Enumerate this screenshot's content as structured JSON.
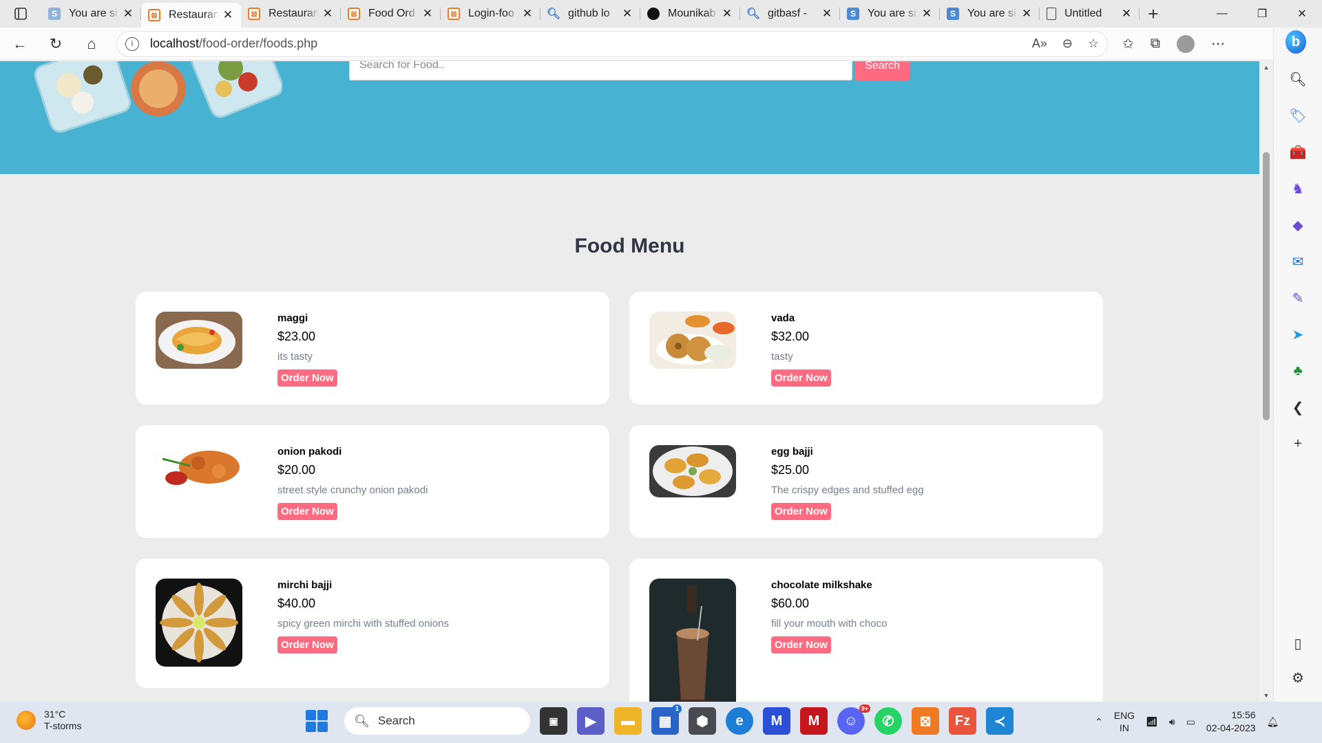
{
  "browser": {
    "tabs": [
      {
        "title": "You are si",
        "icon": "s-icon"
      },
      {
        "title": "Restauran",
        "icon": "xampp-icon",
        "active": true
      },
      {
        "title": "Restauran",
        "icon": "xampp-icon"
      },
      {
        "title": "Food Ord",
        "icon": "xampp-icon"
      },
      {
        "title": "Login-foo",
        "icon": "xampp-icon"
      },
      {
        "title": "github lo",
        "icon": "search-icon"
      },
      {
        "title": "Mounikab",
        "icon": "github-icon"
      },
      {
        "title": "gitbasf - ",
        "icon": "search-icon"
      },
      {
        "title": "You are si",
        "icon": "s-icon"
      },
      {
        "title": "You are si",
        "icon": "s-icon"
      },
      {
        "title": "Untitled",
        "icon": "doc-icon"
      }
    ],
    "url_host": "localhost",
    "url_path": "/food-order/foods.php"
  },
  "page": {
    "search_placeholder": "Search for Food..",
    "search_button": "Search",
    "menu_title": "Food Menu",
    "foods": [
      {
        "name": "maggi",
        "price": "$23.00",
        "desc": "its tasty",
        "button": "Order Now"
      },
      {
        "name": "vada",
        "price": "$32.00",
        "desc": "tasty",
        "button": "Order Now"
      },
      {
        "name": "onion pakodi",
        "price": "$20.00",
        "desc": "street style crunchy onion pakodi",
        "button": "Order Now"
      },
      {
        "name": "egg bajji",
        "price": "$25.00",
        "desc": "The crispy edges and stuffed egg",
        "button": "Order Now"
      },
      {
        "name": "mirchi bajji",
        "price": "$40.00",
        "desc": "spicy green mirchi with stuffed onions",
        "button": "Order Now"
      },
      {
        "name": "chocolate milkshake",
        "price": "$60.00",
        "desc": "fill your mouth with choco",
        "button": "Order Now"
      }
    ]
  },
  "taskbar": {
    "weather_temp": "31°C",
    "weather_text": "T-storms",
    "search_label": "Search",
    "lang_top": "ENG",
    "lang_bottom": "IN",
    "time": "15:56",
    "date": "02-04-2023",
    "store_badge": "1",
    "discord_badge": "9+"
  },
  "colors": {
    "hero": "#47b2d2",
    "accent": "#ff6b81",
    "page_bg": "#ececec"
  }
}
